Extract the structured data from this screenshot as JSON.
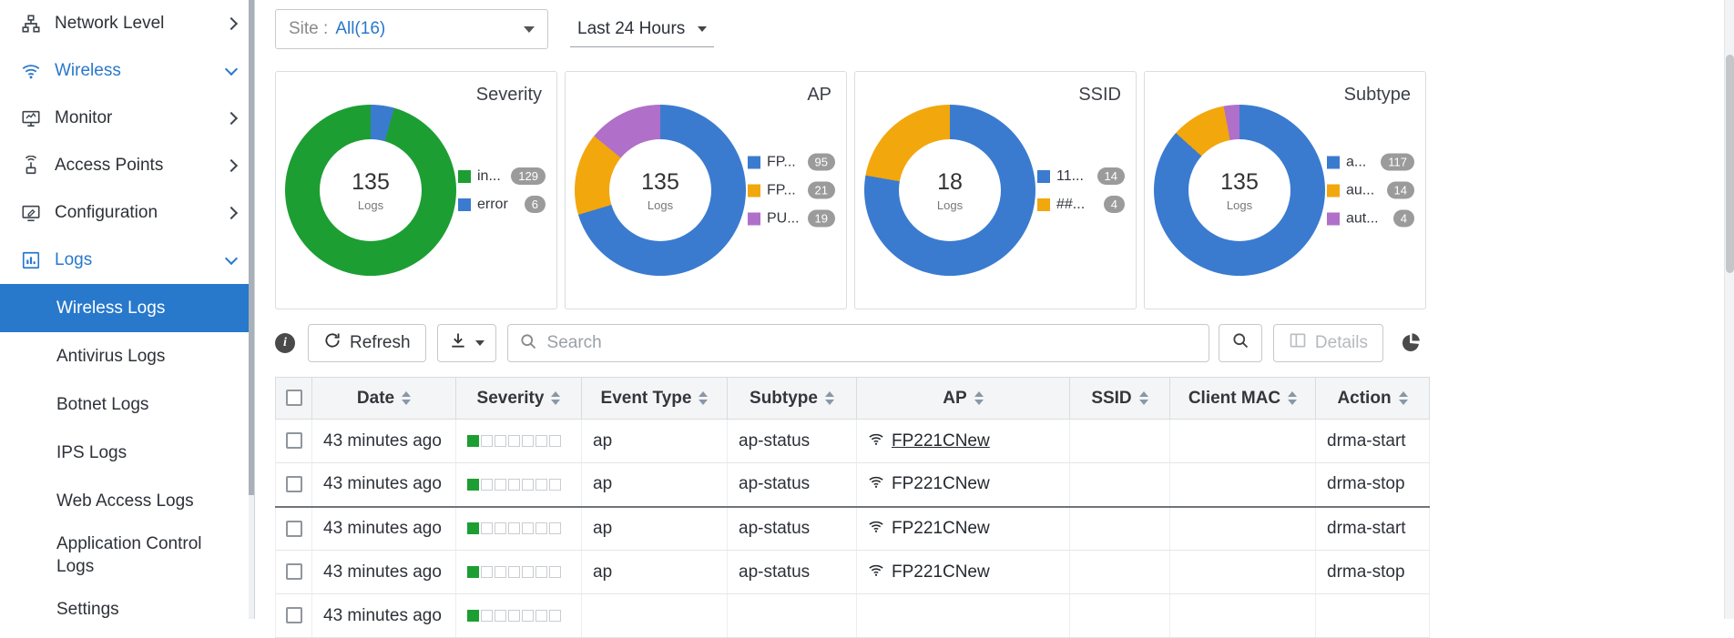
{
  "sidebar": {
    "items": [
      {
        "label": "Network Level",
        "active": false,
        "expanded": false
      },
      {
        "label": "Wireless",
        "active": true,
        "expanded": true
      },
      {
        "label": "Monitor",
        "active": false,
        "expanded": false
      },
      {
        "label": "Access Points",
        "active": false,
        "expanded": false
      },
      {
        "label": "Configuration",
        "active": false,
        "expanded": false
      },
      {
        "label": "Logs",
        "active": true,
        "expanded": true
      }
    ],
    "log_items": [
      {
        "label": "Wireless Logs",
        "selected": true
      },
      {
        "label": "Antivirus Logs",
        "selected": false
      },
      {
        "label": "Botnet Logs",
        "selected": false
      },
      {
        "label": "IPS Logs",
        "selected": false
      },
      {
        "label": "Web Access Logs",
        "selected": false
      },
      {
        "label": "Application Control Logs",
        "selected": false
      },
      {
        "label": "Settings",
        "selected": false
      }
    ]
  },
  "filters": {
    "site_label": "Site :",
    "site_value": "All(16)",
    "time_range": "Last 24 Hours"
  },
  "chart_data": [
    {
      "type": "pie",
      "title": "Severity",
      "total": 135,
      "center_value": "135",
      "center_label": "Logs",
      "start_angle_deg": 16,
      "legend_position": "right",
      "slices": [
        {
          "label": "in...",
          "value": 129,
          "color": "#1d9e33"
        },
        {
          "label": "error",
          "value": 6,
          "color": "#3a7bd0"
        }
      ]
    },
    {
      "type": "pie",
      "title": "AP",
      "total": 135,
      "center_value": "135",
      "center_label": "Logs",
      "start_angle_deg": 0,
      "legend_position": "right",
      "slices": [
        {
          "label": "FP...",
          "value": 95,
          "color": "#3a7bd0"
        },
        {
          "label": "FP...",
          "value": 21,
          "color": "#f2a70d"
        },
        {
          "label": "PU...",
          "value": 19,
          "color": "#b06fc9"
        }
      ]
    },
    {
      "type": "pie",
      "title": "SSID",
      "total": 18,
      "center_value": "18",
      "center_label": "Logs",
      "start_angle_deg": 0,
      "legend_position": "right",
      "slices": [
        {
          "label": "11...",
          "value": 14,
          "color": "#3a7bd0"
        },
        {
          "label": "##...",
          "value": 4,
          "color": "#f2a70d"
        }
      ]
    },
    {
      "type": "pie",
      "title": "Subtype",
      "total": 135,
      "center_value": "135",
      "center_label": "Logs",
      "start_angle_deg": 0,
      "legend_position": "right",
      "slices": [
        {
          "label": "a...",
          "value": 117,
          "color": "#3a7bd0"
        },
        {
          "label": "au...",
          "value": 14,
          "color": "#f2a70d"
        },
        {
          "label": "aut...",
          "value": 4,
          "color": "#b06fc9"
        }
      ]
    }
  ],
  "toolbar": {
    "refresh_label": "Refresh",
    "search_placeholder": "Search",
    "details_label": "Details"
  },
  "table": {
    "columns": [
      "Date",
      "Severity",
      "Event Type",
      "Subtype",
      "AP",
      "SSID",
      "Client MAC",
      "Action"
    ],
    "severity_scale": 7,
    "rows": [
      {
        "date": "43 minutes ago",
        "severity_level": 1,
        "event_type": "ap",
        "subtype": "ap-status",
        "ap": "FP221CNew",
        "ssid": "",
        "client_mac": "",
        "action": "drma-start"
      },
      {
        "date": "43 minutes ago",
        "severity_level": 1,
        "event_type": "ap",
        "subtype": "ap-status",
        "ap": "FP221CNew",
        "ssid": "",
        "client_mac": "",
        "action": "drma-stop"
      },
      {
        "date": "43 minutes ago",
        "severity_level": 1,
        "event_type": "ap",
        "subtype": "ap-status",
        "ap": "FP221CNew",
        "ssid": "",
        "client_mac": "",
        "action": "drma-start"
      },
      {
        "date": "43 minutes ago",
        "severity_level": 1,
        "event_type": "ap",
        "subtype": "ap-status",
        "ap": "FP221CNew",
        "ssid": "",
        "client_mac": "",
        "action": "drma-stop"
      },
      {
        "date": "43 minutes ago",
        "severity_level": 1,
        "event_type": "",
        "subtype": "",
        "ap": "",
        "ssid": "",
        "client_mac": "",
        "action": ""
      }
    ]
  },
  "colors": {
    "accent_blue": "#2878cc",
    "severity_green": "#1d9e33",
    "donut_blue": "#3a7bd0",
    "donut_orange": "#f2a70d",
    "donut_purple": "#b06fc9",
    "badge_gray": "#9b9b9b"
  }
}
